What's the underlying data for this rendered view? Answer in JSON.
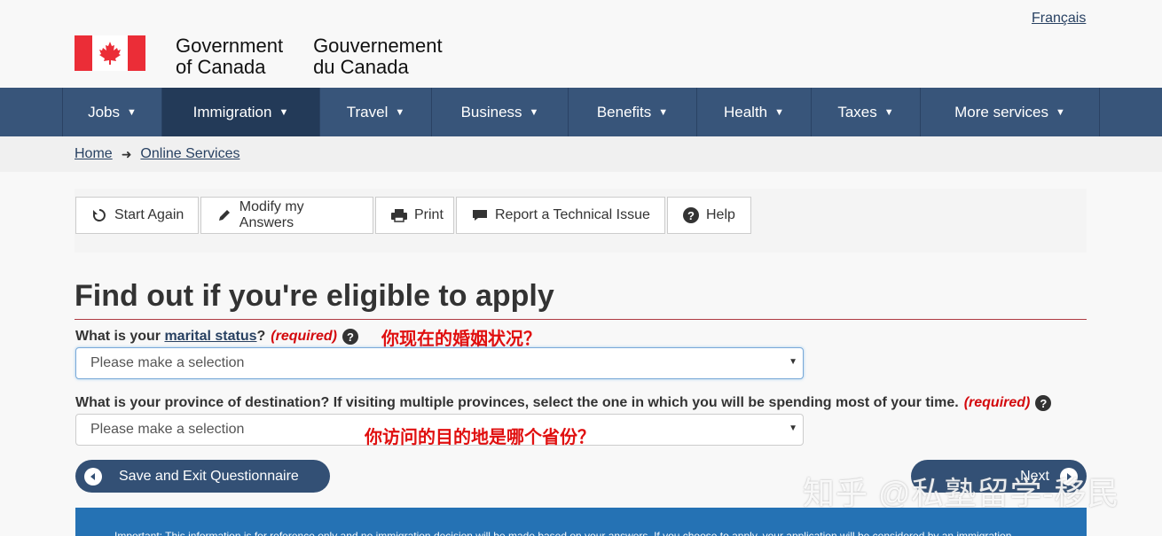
{
  "header": {
    "lang_link": "Français",
    "sig_en_1": "Government",
    "sig_en_2": "of Canada",
    "sig_fr_1": "Gouvernement",
    "sig_fr_2": "du Canada",
    "flag_color": "#eb2d37"
  },
  "nav": {
    "items": [
      {
        "label": "Jobs"
      },
      {
        "label": "Immigration",
        "active": true
      },
      {
        "label": "Travel"
      },
      {
        "label": "Business"
      },
      {
        "label": "Benefits"
      },
      {
        "label": "Health"
      },
      {
        "label": "Taxes"
      },
      {
        "label": "More services"
      }
    ],
    "color": "#38557a"
  },
  "breadcrumb": {
    "home": "Home",
    "online_services": "Online Services"
  },
  "toolbar": {
    "start_again": "Start Again",
    "modify": "Modify my Answers",
    "print": "Print",
    "report": "Report a Technical Issue",
    "help": "Help"
  },
  "main": {
    "title": "Find out if you're eligible to apply",
    "q1": {
      "prefix": "What is your ",
      "link": "marital status",
      "suffix": "?",
      "required": "(required)",
      "note": "你现在的婚姻状况？",
      "select_value": "Please make a selection"
    },
    "q2": {
      "text": "What is your province of destination? If visiting multiple provinces, select the one in which you will be spending most of your time.",
      "required": "(required)",
      "note": "你访问的目的地是哪个省份？",
      "select_value": "Please make a selection"
    },
    "save_exit": "Save and Exit Questionnaire",
    "next": "Next",
    "watermark": "知乎 @私塾留学-移民",
    "important": "Important: This information is for reference only and no immigration decision will be made based on your answers. If you choose to apply, your application will be considered by an immigration"
  }
}
